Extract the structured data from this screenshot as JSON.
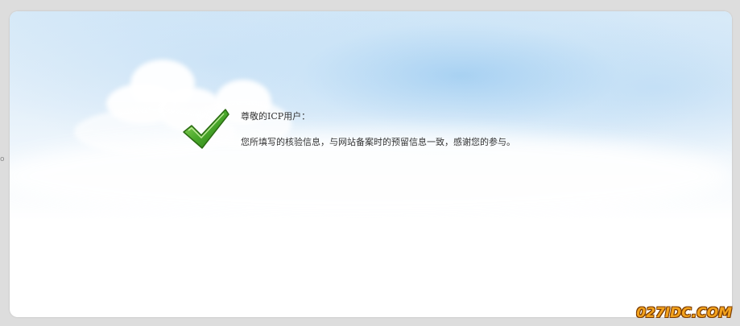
{
  "edge_mark": "o",
  "notice": {
    "greeting": "尊敬的ICP用户：",
    "message": "您所填写的核验信息，与网站备案时的预留信息一致，感谢您的参与。",
    "icon": "checkmark-icon"
  },
  "watermark": {
    "text": "027IDC.COM"
  },
  "colors": {
    "background": "#dddddd",
    "panel": "#ffffff",
    "check_green": "#4aa92b",
    "text": "#333333",
    "watermark": "#f3a21c"
  }
}
